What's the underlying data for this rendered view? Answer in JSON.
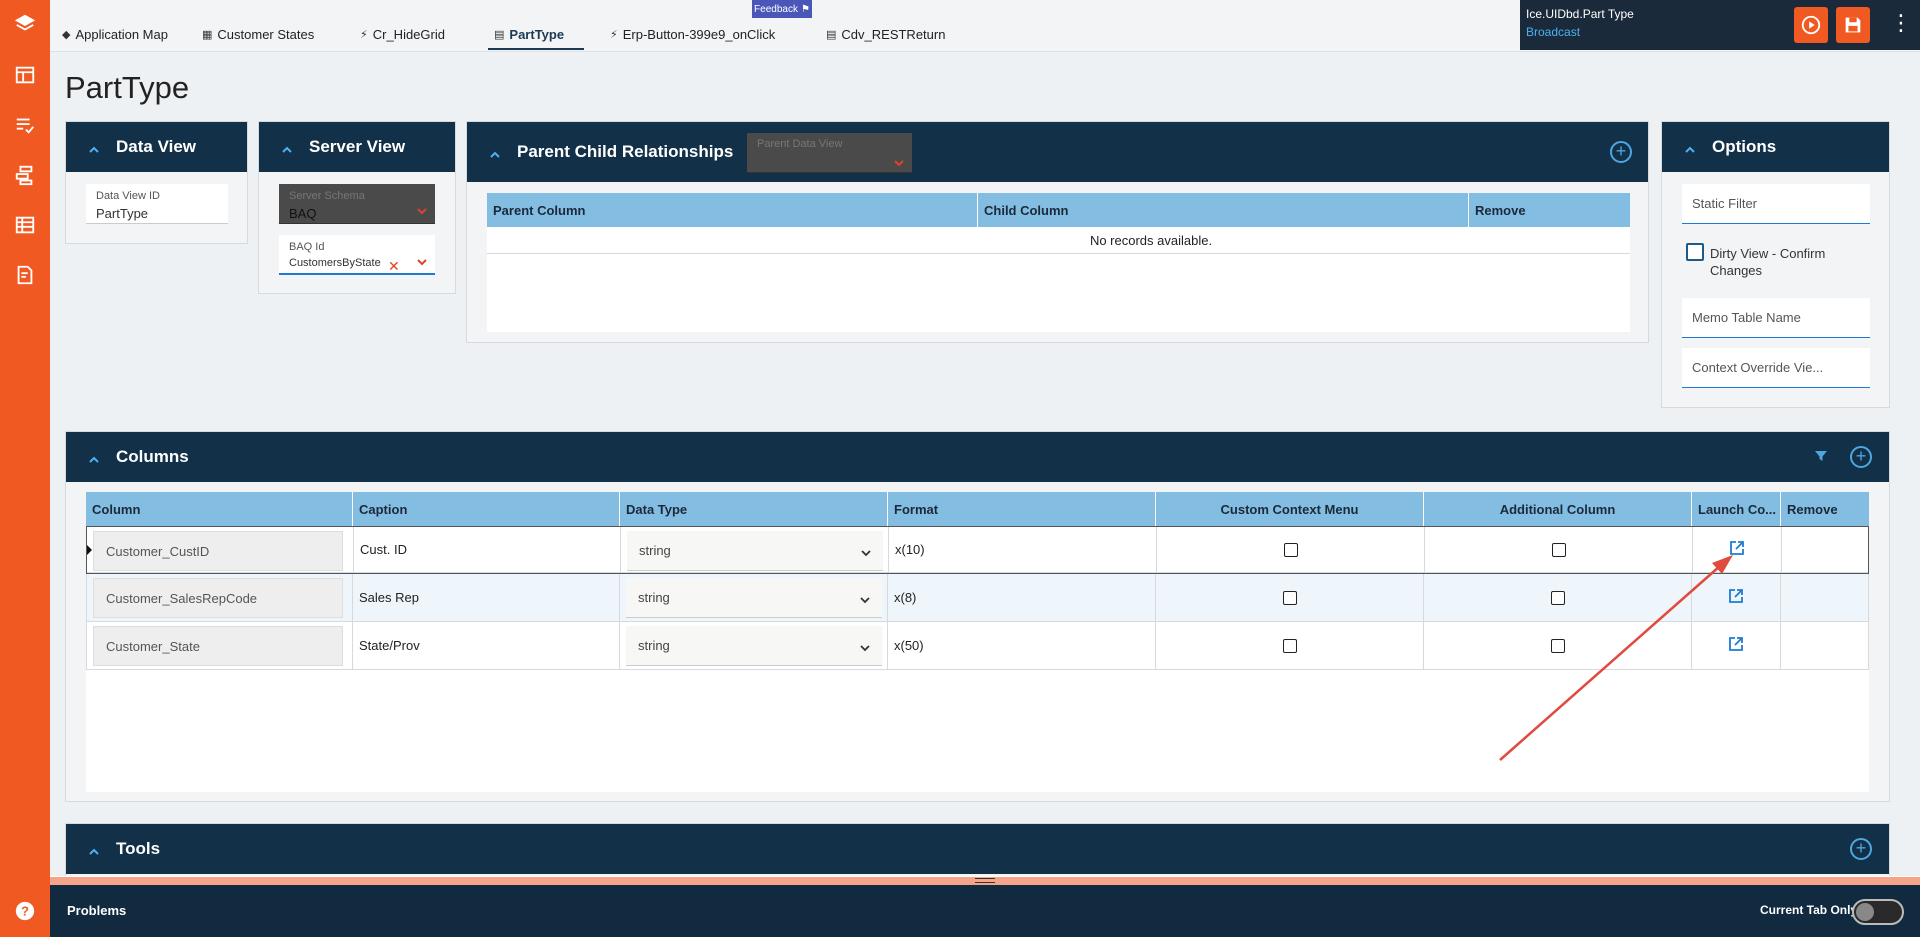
{
  "rail": {
    "icons": [
      "layers-icon",
      "dashboard-icon",
      "checklist-icon",
      "hierarchy-icon",
      "grid-icon",
      "document-edit-icon",
      "help-icon"
    ]
  },
  "tabs": [
    {
      "label": "Application Map",
      "icon": "layers-icon"
    },
    {
      "label": "Customer States",
      "icon": "table-icon"
    },
    {
      "label": "Cr_HideGrid",
      "icon": "event-icon"
    },
    {
      "label": "PartType",
      "icon": "page-icon",
      "active": true
    },
    {
      "label": "Erp-Button-399e9_onClick",
      "icon": "event-icon"
    },
    {
      "label": "Cdv_RESTReturn",
      "icon": "page-icon"
    }
  ],
  "feedback": {
    "label": "Feedback"
  },
  "app": {
    "name": "Ice.UIDbd.Part Type",
    "broadcast": "Broadcast"
  },
  "page_title": "PartType",
  "data_view": {
    "title": "Data View",
    "id_label": "Data View ID",
    "id_value": "PartType"
  },
  "server_view": {
    "title": "Server View",
    "schema_label": "Server Schema",
    "schema_value": "BAQ",
    "baq_label": "BAQ Id",
    "baq_value": "CustomersByState"
  },
  "parent_child": {
    "title": "Parent Child Relationships",
    "parent_dv_placeholder": "Parent Data View",
    "headers": [
      "Parent Column",
      "Child Column",
      "Remove"
    ],
    "empty": "No records available."
  },
  "options": {
    "title": "Options",
    "static_filter": "Static Filter",
    "dirty_view": "Dirty View - Confirm Changes",
    "memo_table": "Memo Table Name",
    "context_override": "Context Override Vie..."
  },
  "columns": {
    "title": "Columns",
    "headers": [
      "Column",
      "Caption",
      "Data Type",
      "Format",
      "Custom Context Menu",
      "Additional Column",
      "Launch Co...",
      "Remove"
    ],
    "rows": [
      {
        "column": "Customer_CustID",
        "caption": "Cust. ID",
        "type": "string",
        "format": "x(10)"
      },
      {
        "column": "Customer_SalesRepCode",
        "caption": "Sales Rep",
        "type": "string",
        "format": "x(8)"
      },
      {
        "column": "Customer_State",
        "caption": "State/Prov",
        "type": "string",
        "format": "x(50)"
      }
    ]
  },
  "tools": {
    "title": "Tools"
  },
  "problems": {
    "title": "Problems",
    "current_tab_only": "Current Tab Only"
  },
  "colors": {
    "rail": "#f05a22",
    "header": "#123047",
    "table_header": "#84bde2",
    "accent": "#4cb1f0",
    "arrow": "#e04a3f"
  }
}
